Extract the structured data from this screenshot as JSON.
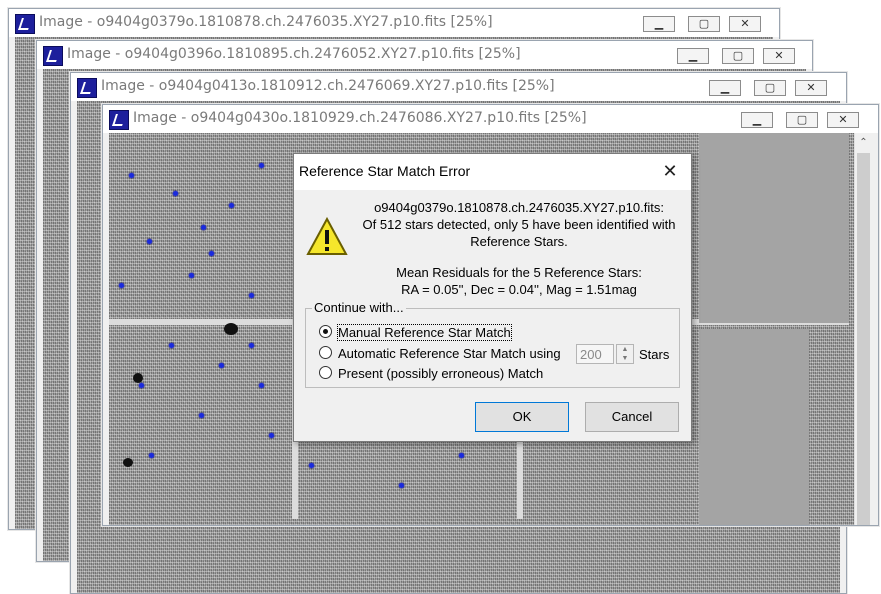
{
  "windows": [
    {
      "title": "Image - o9404g0379o.1810878.ch.2476035.XY27.p10.fits [25%]"
    },
    {
      "title": "Image - o9404g0396o.1810895.ch.2476052.XY27.p10.fits [25%]"
    },
    {
      "title": "Image - o9404g0413o.1810912.ch.2476069.XY27.p10.fits [25%]"
    },
    {
      "title": "Image - o9404g0430o.1810929.ch.2476086.XY27.p10.fits [25%]"
    }
  ],
  "dialog": {
    "title": "Reference Star Match Error",
    "close_glyph": "✕",
    "message_file": "o9404g0379o.1810878.ch.2476035.XY27.p10.fits:",
    "message_line1": "Of 512 stars detected, only 5 have been identified with",
    "message_line2": "Reference Stars.",
    "residuals_title": "Mean Residuals for the 5 Reference Stars:",
    "residuals_values": "RA = 0.05'',  Dec = 0.04'',  Mag = 1.51mag",
    "group_label": "Continue with...",
    "options": {
      "manual": "Manual Reference Star Match",
      "automatic": "Automatic Reference Star Match using",
      "present": "Present (possibly erroneous) Match"
    },
    "selected_option": "manual",
    "stars_value": "200",
    "stars_label": "Stars",
    "ok_label": "OK",
    "cancel_label": "Cancel"
  },
  "colors": {
    "star_marker": "#1a2adf",
    "focus_border": "#0078d7"
  },
  "icons": {
    "window_icon": "app-image-icon",
    "warning": "warning-icon",
    "close": "close-icon"
  }
}
